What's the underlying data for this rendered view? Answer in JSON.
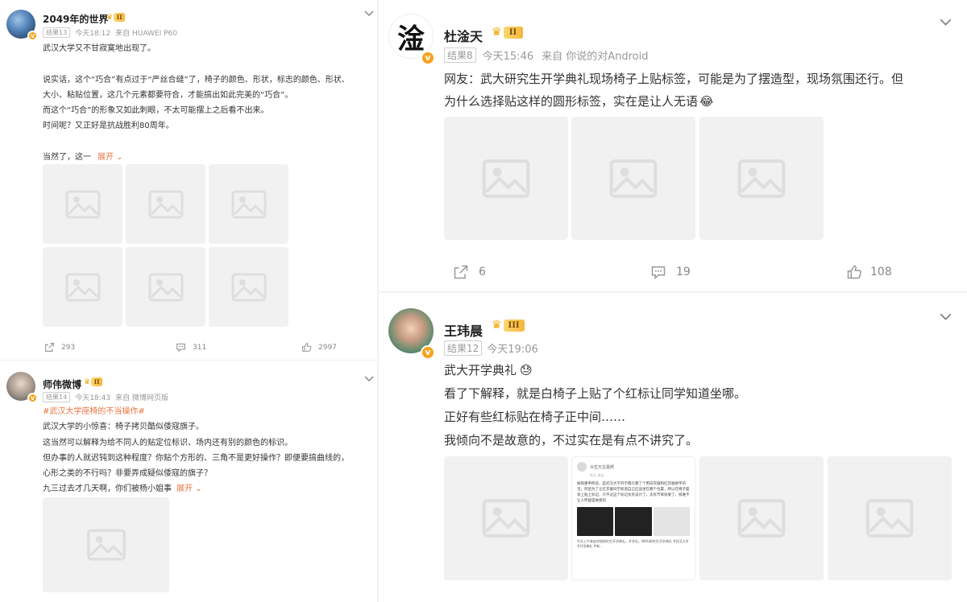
{
  "posts": [
    {
      "username": "2049年的世界",
      "vip_level": "II",
      "result_tag": "结果13",
      "time": "今天18:12",
      "source": "来自 HUAWEI P60",
      "lines": [
        "武汉大学又不甘寂寞地出现了。",
        "",
        "说实话，这个“巧合”有点过于“严丝合缝”了，椅子的颜色、形状，标志的颜色、形状、",
        "大小、粘贴位置，这几个元素都要符合，才能搞出如此完美的“巧合”。",
        "而这个“巧合”的形象又如此刺眼，不太可能摆上之后看不出来。",
        "时间呢？又正好是抗战胜利80周年。",
        "",
        "当然了，这一"
      ],
      "expand_label": "展开",
      "reposts": "293",
      "comments": "311",
      "likes": "2997"
    },
    {
      "username": "师伟微博",
      "vip_level": "II",
      "result_tag": "结果14",
      "time": "今天18:43",
      "source": "来自 微博网页版",
      "hashtag": "#武汉大学座椅的不当操作#",
      "lines": [
        "武汉大学的小惊喜：椅子拷贝酷似倭寇旗子。",
        "这当然可以解释为给不同人的贴定位标识、场内还有别的颜色的标识。",
        "但办事的人就迟钝到这种程度？你贴个方形的、三角不是更好操作？即便要搞曲线的，",
        "心形之类的不行吗？非要弄成疑似倭寇的旗子？",
        "九三过去才几天啊，你们被杨小姐事"
      ],
      "expand_label": "展开"
    },
    {
      "username": "杜淦天",
      "avatar_char": "淦",
      "vip_level": "II",
      "result_tag": "结果8",
      "time": "今天15:46",
      "source": "来自 你说的对Android",
      "lines": [
        "网友：武大研究生开学典礼现场椅子上贴标签，可能是为了摆造型，现场氛围还行。但",
        "为什么选择贴这样的圆形标签，实在是让人无语"
      ],
      "emoji": "😂",
      "reposts": "6",
      "comments": "19",
      "likes": "108"
    },
    {
      "username": "王玮晨",
      "vip_level": "III",
      "result_tag": "结果12",
      "time": "今天19:06",
      "lines": [
        "武大开学典礼",
        "看了下解释，就是白椅子上贴了个红标让同学知道坐哪。",
        "正好有些红标贴在椅子正中间……",
        "我倾向不是故意的，不过实在是有点不讲究了。"
      ],
      "emoji": "😓",
      "screenshot": {
        "author": "众生万古嘉邦",
        "sub": "昨天 来自",
        "body": "按照重申所说，是武汉大学开学典礼整了个用白衣服和红衣服拼字的活，然后为了让红衣服同学知道自己应该坐在哪个位置，所以在椅子面背上贴上标记，只不过这个标记太有设计了，太有节目效果了，很难不让人怀疑是故意的",
        "footer": "今天上午参加学校研究生开学典礼，开学礼。WHU研究生开学典礼 #武汉大学 #开学典礼 #新..."
      }
    }
  ],
  "colors": {
    "accent_orange": "#eb7340",
    "vip_gold": "#f5b63a",
    "verified_badge": "#f7a11b"
  },
  "icons": [
    "chevron-down-icon",
    "repost-icon",
    "comment-icon",
    "like-icon",
    "image-placeholder-icon",
    "verified-icon",
    "crown-icon"
  ]
}
